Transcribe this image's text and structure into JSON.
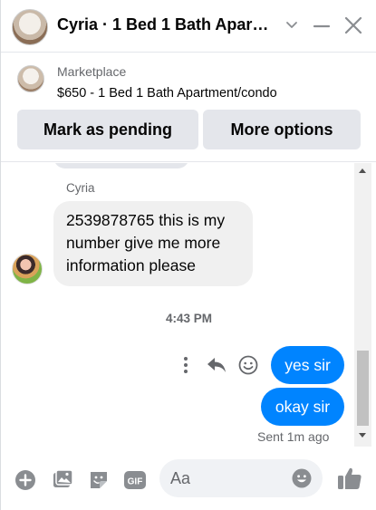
{
  "header": {
    "title": "Cyria · 1 Bed 1 Bath Apart…",
    "icons": [
      "chevron-down-icon",
      "minimize-icon",
      "close-icon"
    ]
  },
  "marketplace": {
    "label": "Marketplace",
    "item": "$650 - 1 Bed 1 Bath Apartment/condo",
    "mark_pending_label": "Mark as pending",
    "more_options_label": "More options"
  },
  "conversation": {
    "sender_name": "Cyria",
    "incoming_message": "2539878765 this is my number give me more information please",
    "timestamp": "4:43 PM",
    "outgoing_messages": [
      "yes sir",
      "okay sir"
    ],
    "status": "Sent 1m ago"
  },
  "composer": {
    "placeholder": "Aa",
    "icons": [
      "add-icon",
      "photo-icon",
      "sticker-icon",
      "gif-icon",
      "emoji-icon",
      "like-icon"
    ]
  },
  "colors": {
    "accent": "#0084ff",
    "bubble_incoming": "#f0f0f0",
    "button_bg": "#e4e6eb",
    "muted_text": "#65676b"
  }
}
